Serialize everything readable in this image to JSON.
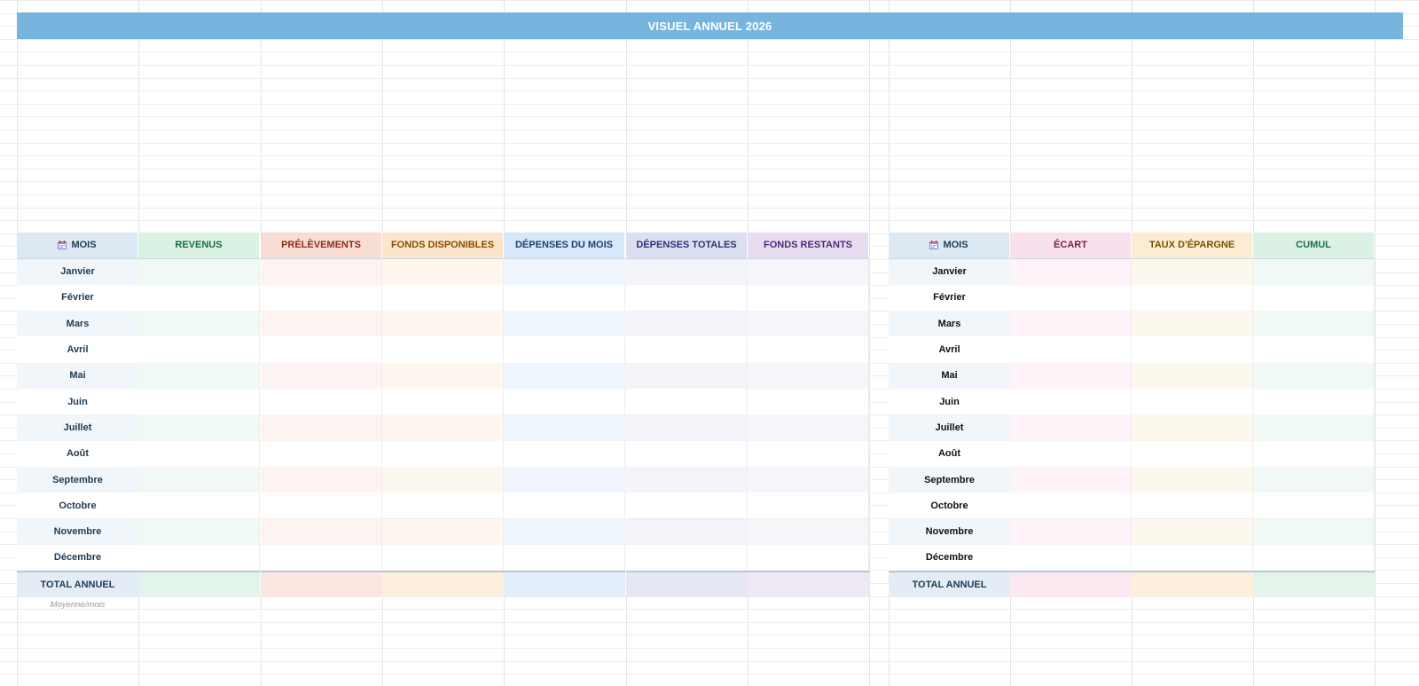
{
  "title": "VISUEL ANNUEL 2026",
  "left_table": {
    "headers": [
      {
        "label": "MOIS",
        "icon": "calendar-icon",
        "bg": "#dce9f3",
        "color": "#1f3a52"
      },
      {
        "label": "REVENUS",
        "bg": "#d9f2e4",
        "color": "#1e6b3f"
      },
      {
        "label": "PRÉLÈVEMENTS",
        "bg": "#f9ddd5",
        "color": "#8b2e1a"
      },
      {
        "label": "FONDS DISPONIBLES",
        "bg": "#fbe6cc",
        "color": "#8a4d00"
      },
      {
        "label": "DÉPENSES DU MOIS",
        "bg": "#d6e8fa",
        "color": "#1c3f6e"
      },
      {
        "label": "DÉPENSES TOTALES",
        "bg": "#dcdff2",
        "color": "#2d3475"
      },
      {
        "label": "FONDS RESTANTS",
        "bg": "#e6ddf0",
        "color": "#4d2a78"
      }
    ],
    "row_tints": [
      "#f1f6fb",
      "#f0f9f4",
      "#fdf4f1",
      "#fdf7ef",
      "#f0f6fd",
      "#f3f3fa",
      "#f7f4fa"
    ],
    "total_tints": [
      "#e4edf5",
      "#e3f4ea",
      "#fbe6e0",
      "#fcefdd",
      "#e2eefa",
      "#e5e7f5",
      "#efe9f6"
    ],
    "total_label": "TOTAL ANNUEL",
    "avg_label": "Moyenne/mois"
  },
  "right_table": {
    "headers": [
      {
        "label": "MOIS",
        "icon": "calendar-icon",
        "bg": "#dce9f3",
        "color": "#1f3a52"
      },
      {
        "label": "ÉCART",
        "bg": "#f8e1ec",
        "color": "#7a1f4b"
      },
      {
        "label": "TAUX D'ÉPARGNE",
        "bg": "#fbecd3",
        "color": "#7a5200"
      },
      {
        "label": "CUMUL",
        "bg": "#dbf1e4",
        "color": "#1e6b4f"
      }
    ],
    "row_tints": [
      "#f1f6fb",
      "#fdf3f8",
      "#fdf8ee",
      "#f1f9f4"
    ],
    "total_tints": [
      "#e4edf5",
      "#fbe8f1",
      "#fcefdc",
      "#e4f4ea"
    ],
    "total_label": "TOTAL ANNUEL"
  },
  "months": [
    "Janvier",
    "Février",
    "Mars",
    "Avril",
    "Mai",
    "Juin",
    "Juillet",
    "Août",
    "Septembre",
    "Octobre",
    "Novembre",
    "Décembre"
  ]
}
